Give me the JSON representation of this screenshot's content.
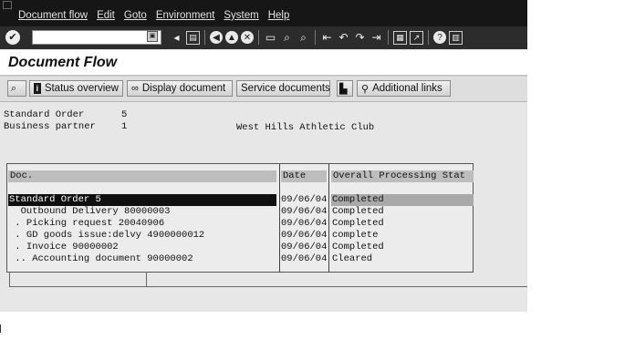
{
  "menu": [
    "Document flow",
    "Edit",
    "Goto",
    "Environment",
    "System",
    "Help"
  ],
  "toolbar": {
    "command_value": "",
    "icons": [
      "enter-icon",
      "back-icon",
      "exit-icon",
      "cancel-icon",
      "print-icon",
      "find-icon",
      "find-next-icon",
      "first-page-icon",
      "previous-page-icon",
      "next-page-icon",
      "last-page-icon",
      "create-session-icon",
      "shortcut-icon",
      "help-icon",
      "layout-icon"
    ]
  },
  "title": "Document Flow",
  "app_toolbar": {
    "status_overview": "Status overview",
    "display_document": "Display document",
    "service_documents": "Service documents",
    "additional_links": "Additional links"
  },
  "header": {
    "order_label": "Standard Order",
    "order_value": "5",
    "partner_label": "Business partner",
    "partner_value": "1",
    "partner_name": "West Hills Athletic Club"
  },
  "table": {
    "columns": [
      "Doc.",
      "Date",
      "Overall Processing Stat"
    ],
    "rows": [
      {
        "doc": "Standard Order 5",
        "date": "09/06/04",
        "status": "Completed"
      },
      {
        "doc": "  Outbound Delivery 80000003",
        "date": "09/06/04",
        "status": "Completed"
      },
      {
        "doc": " . Picking request 20040906",
        "date": "09/06/04",
        "status": "Completed"
      },
      {
        "doc": " . GD goods issue:delvy 4900000012",
        "date": "09/06/04",
        "status": "complete"
      },
      {
        "doc": " . Invoice 90000002",
        "date": "09/06/04",
        "status": "Completed"
      },
      {
        "doc": " .. Accounting document 90000002",
        "date": "09/06/04",
        "status": "Cleared"
      }
    ]
  }
}
